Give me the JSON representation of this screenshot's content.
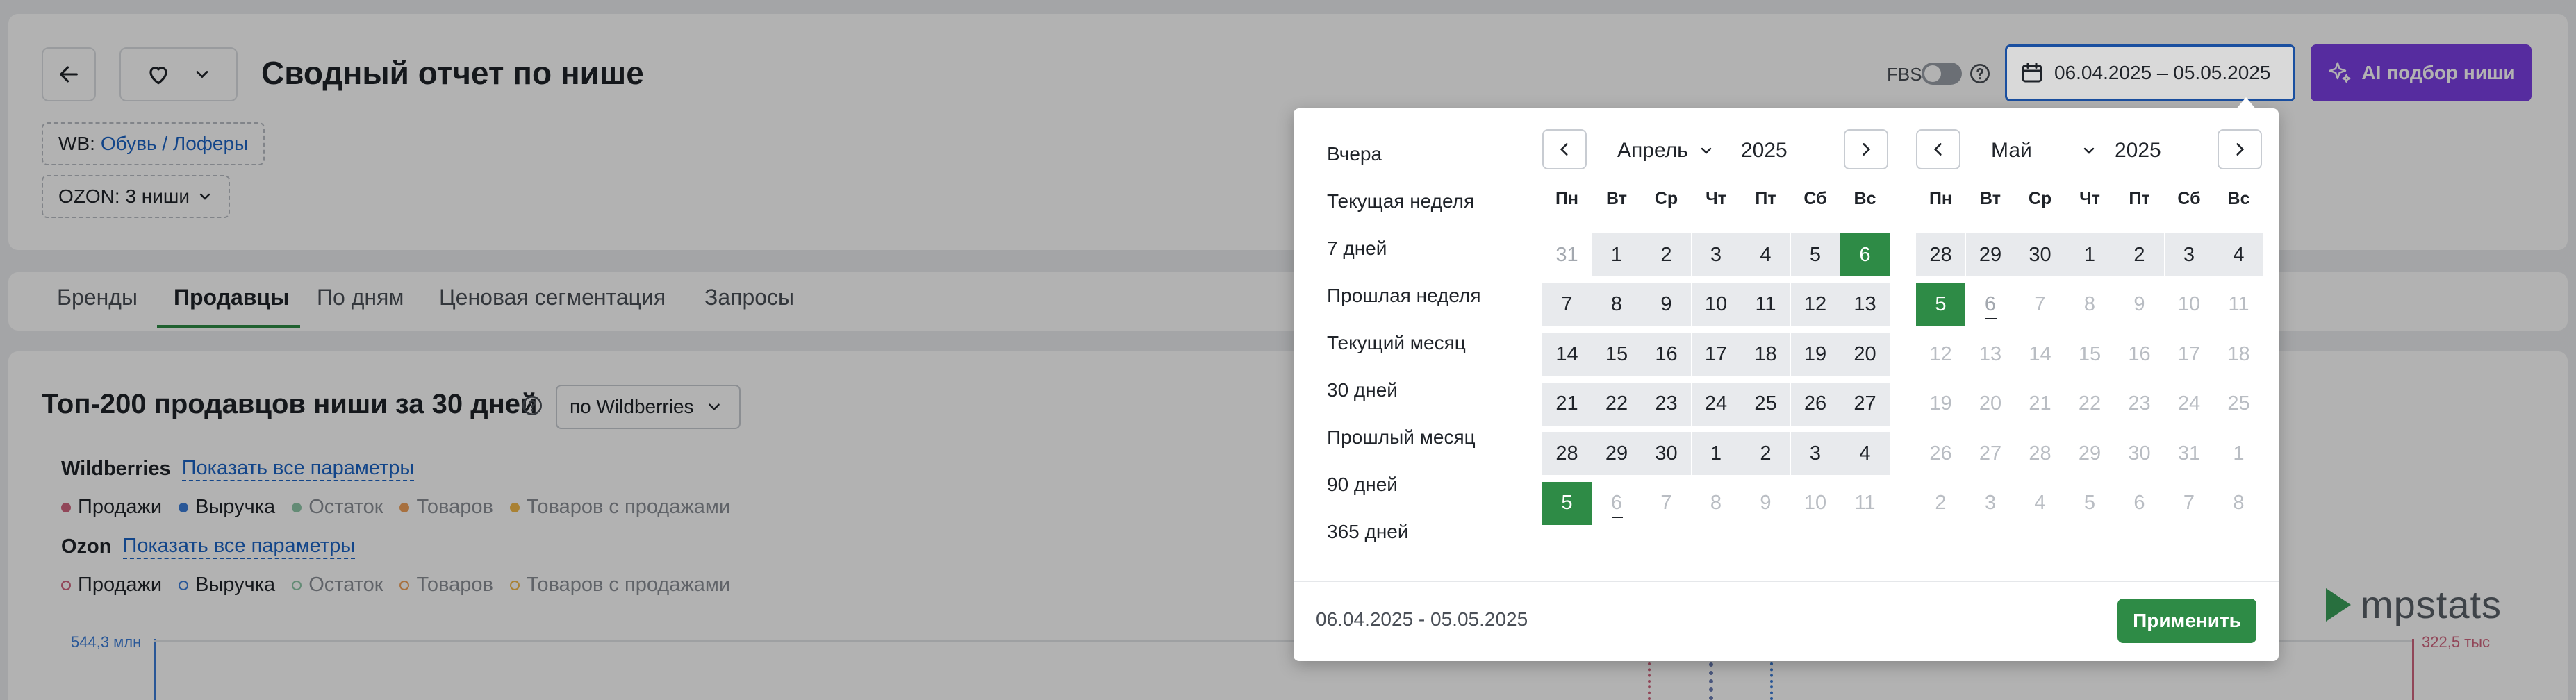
{
  "header": {
    "title": "Сводный отчет по нише",
    "fbs_label": "FBS",
    "date_range": "06.04.2025 – 05.05.2025",
    "ai_button": "AI подбор ниши"
  },
  "filters": {
    "wb_prefix": "WB:",
    "wb_link": "Обувь / Лоферы",
    "ozon_label": "OZON: 3 ниши"
  },
  "tabs": [
    {
      "label": "Бренды"
    },
    {
      "label": "Продавцы"
    },
    {
      "label": "По дням"
    },
    {
      "label": "Ценовая сегментация"
    },
    {
      "label": "Запросы"
    }
  ],
  "section": {
    "title": "Топ-200 продавцов ниши за 30 дней",
    "source_select": "по Wildberries"
  },
  "legend": {
    "wb_label": "Wildberries",
    "wb_show_all": "Показать все параметры",
    "ozon_label": "Ozon",
    "ozon_show_all": "Показать все параметры",
    "items": [
      "Продажи",
      "Выручка",
      "Остаток",
      "Товаров",
      "Товаров с продажами"
    ],
    "colors": {
      "sales": "#d0657f",
      "revenue": "#3b7dd8",
      "stock": "#8fc7a8",
      "goods": "#f0a15b",
      "goods_with_sales": "#f2b94a"
    }
  },
  "chart_axis": {
    "left_value": "544,3 млн",
    "right_value": "322,5 тыс"
  },
  "brand": {
    "logo_text": "mpstats"
  },
  "picker": {
    "presets": [
      "Вчера",
      "Текущая неделя",
      "7 дней",
      "Прошлая неделя",
      "Текущий месяц",
      "30 дней",
      "Прошлый месяц",
      "90 дней",
      "365 дней"
    ],
    "weekdays": [
      "Пн",
      "Вт",
      "Ср",
      "Чт",
      "Пт",
      "Сб",
      "Вс"
    ],
    "left": {
      "month": "Апрель",
      "year": "2025",
      "days": [
        [
          "31",
          "1",
          "2",
          "3",
          "4",
          "5",
          "6"
        ],
        [
          "7",
          "8",
          "9",
          "10",
          "11",
          "12",
          "13"
        ],
        [
          "14",
          "15",
          "16",
          "17",
          "18",
          "19",
          "20"
        ],
        [
          "21",
          "22",
          "23",
          "24",
          "25",
          "26",
          "27"
        ],
        [
          "28",
          "29",
          "30",
          "1",
          "2",
          "3",
          "4"
        ],
        [
          "5",
          "6",
          "7",
          "8",
          "9",
          "10",
          "11"
        ]
      ]
    },
    "right": {
      "month": "Май",
      "year": "2025",
      "days": [
        [
          "28",
          "29",
          "30",
          "1",
          "2",
          "3",
          "4"
        ],
        [
          "5",
          "6",
          "7",
          "8",
          "9",
          "10",
          "11"
        ],
        [
          "12",
          "13",
          "14",
          "15",
          "16",
          "17",
          "18"
        ],
        [
          "19",
          "20",
          "21",
          "22",
          "23",
          "24",
          "25"
        ],
        [
          "26",
          "27",
          "28",
          "29",
          "30",
          "31",
          "1"
        ],
        [
          "2",
          "3",
          "4",
          "5",
          "6",
          "7",
          "8"
        ]
      ]
    },
    "footer_range": "06.04.2025 - 05.05.2025",
    "apply_label": "Применить"
  }
}
